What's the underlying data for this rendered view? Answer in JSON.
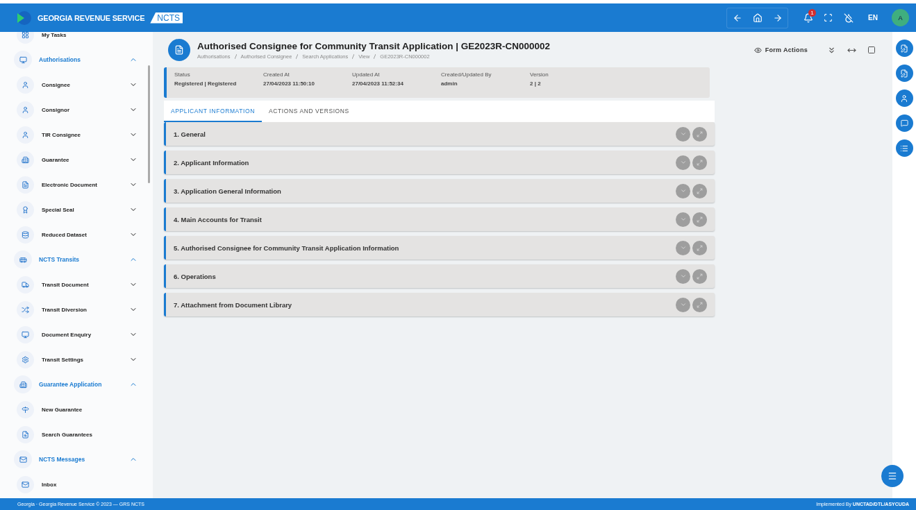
{
  "header": {
    "brand": "GEORGIA REVENUE SERVICE",
    "product": "NCTS",
    "notification_count": "1",
    "language": "EN",
    "avatar": "A"
  },
  "sidebar": {
    "items": [
      {
        "kind": "link",
        "label": "My Tasks"
      },
      {
        "kind": "group",
        "label": "Authorisations",
        "expanded": true
      },
      {
        "kind": "item",
        "label": "Consignee",
        "expanded": false
      },
      {
        "kind": "item",
        "label": "Consignor",
        "expanded": false
      },
      {
        "kind": "item",
        "label": "TIR Consignee",
        "expanded": false
      },
      {
        "kind": "item",
        "label": "Guarantee",
        "expanded": false
      },
      {
        "kind": "item",
        "label": "Electronic Document",
        "expanded": false
      },
      {
        "kind": "item",
        "label": "Special Seal",
        "expanded": false
      },
      {
        "kind": "item",
        "label": "Reduced Dataset",
        "expanded": false
      },
      {
        "kind": "group",
        "label": "NCTS Transits",
        "expanded": true
      },
      {
        "kind": "item",
        "label": "Transit Document",
        "expanded": false
      },
      {
        "kind": "item",
        "label": "Transit Diversion",
        "expanded": false
      },
      {
        "kind": "item",
        "label": "Document Enquiry",
        "expanded": false
      },
      {
        "kind": "item",
        "label": "Transit Settings",
        "expanded": false
      },
      {
        "kind": "group",
        "label": "Guarantee Application",
        "expanded": true
      },
      {
        "kind": "link",
        "label": "New Guarantee"
      },
      {
        "kind": "link",
        "label": "Search Guarantees"
      },
      {
        "kind": "group",
        "label": "NCTS Messages",
        "expanded": true
      },
      {
        "kind": "link",
        "label": "Inbox"
      }
    ]
  },
  "page": {
    "title": "Authorised Consignee for Community Transit Application | GE2023R-CN000002",
    "breadcrumb": [
      "Authorisations",
      "Authorised Consignee",
      "Search Applications",
      "View",
      "GE2023R-CN000002"
    ],
    "form_actions": "Form Actions",
    "summary": [
      {
        "label": "Status",
        "value": "Registered | Registered"
      },
      {
        "label": "Created At",
        "value": "27/04/2023 11:50:10"
      },
      {
        "label": "Updated At",
        "value": "27/04/2023 11:52:34"
      },
      {
        "label": "Created/Updated By",
        "value": "admin"
      },
      {
        "label": "Version",
        "value": "2 | 2"
      }
    ],
    "tabs": [
      {
        "label": "APPLICANT INFORMATION",
        "selected": true
      },
      {
        "label": "ACTIONS AND VERSIONS",
        "selected": false
      }
    ],
    "sections": [
      "1. General",
      "2. Applicant Information",
      "3. Application General Information",
      "4. Main Accounts for Transit",
      "5. Authorised Consignee for Community Transit Application Information",
      "6. Operations",
      "7. Attachment from Document Library"
    ]
  },
  "footer": {
    "left": "Georgia · Georgia Revenue Service © 2023 — GRS NCTS",
    "right": "Implemented By **UNCTAD/DTL/ASYCUDA**"
  }
}
